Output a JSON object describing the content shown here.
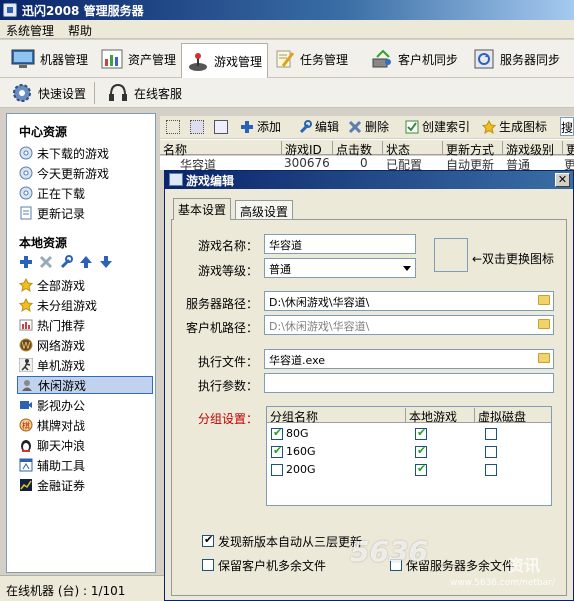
{
  "window": {
    "title": "迅闪2008 管理服务器"
  },
  "menu": {
    "items": [
      "系统管理",
      "帮助"
    ]
  },
  "toolbar": {
    "buttons": [
      "机器管理",
      "资产管理",
      "游戏管理",
      "任务管理",
      "客户机同步",
      "服务器同步"
    ],
    "row2": [
      "快速设置",
      "在线客服"
    ]
  },
  "sidebar": {
    "center_title": "中心资源",
    "center_items": [
      "未下载的游戏",
      "今天更新游戏",
      "正在下载",
      "更新记录"
    ],
    "local_title": "本地资源",
    "local_items": [
      "全部游戏",
      "未分组游戏",
      "热门推荐",
      "网络游戏",
      "单机游戏",
      "休闲游戏",
      "影视办公",
      "棋牌对战",
      "聊天冲浪",
      "辅助工具",
      "金融证券"
    ]
  },
  "status": {
    "text": "在线机器 (台) : 1/101"
  },
  "subtoolbar": {
    "add": "添加",
    "edit": "编辑",
    "delete": "删除",
    "index": "创建索引",
    "icon": "生成图标",
    "search": "搜"
  },
  "grid": {
    "columns": [
      "名称",
      "游戏ID",
      "点击数",
      "状态",
      "更新方式",
      "游戏级别",
      "更"
    ],
    "row": [
      "华容道",
      "300676",
      "0",
      "已配置",
      "自动更新",
      "普通",
      "更"
    ]
  },
  "dialog": {
    "title": "游戏编辑",
    "tabs": [
      "基本设置",
      "高级设置"
    ],
    "labels": {
      "name": "游戏名称：",
      "level": "游戏等级：",
      "server_path": "服务器路径：",
      "client_path": "客户机路径：",
      "exe": "执行文件：",
      "params": "执行参数：",
      "group": "分组设置："
    },
    "values": {
      "name": "华容道",
      "level": "普通",
      "server_path": "D:\\休闲游戏\\华容道\\",
      "client_path": "D:\\休闲游戏\\华容道\\",
      "exe": "华容道.exe",
      "params": ""
    },
    "icon_hint": "←双击更换图标",
    "group_table": {
      "columns": [
        "分组名称",
        "本地游戏",
        "虚拟磁盘"
      ],
      "rows": [
        {
          "name": "80G",
          "checked": true,
          "local": true,
          "virtual": false
        },
        {
          "name": "160G",
          "checked": true,
          "local": true,
          "virtual": false
        },
        {
          "name": "200G",
          "checked": false,
          "local": true,
          "virtual": false
        }
      ]
    },
    "options": {
      "auto_update": "发现新版本自动从三层更新",
      "auto_update_checked": true,
      "keep_client": "保留客户机多余文件",
      "keep_server": "保留服务器多余文件"
    }
  },
  "watermark": {
    "text": "5636",
    "sub": "资讯",
    "url": "www.5636.com/netbar/"
  },
  "colors": {
    "title_blue": "#0a246a",
    "accent_red": "#c00000",
    "check_green": "#21a121"
  }
}
